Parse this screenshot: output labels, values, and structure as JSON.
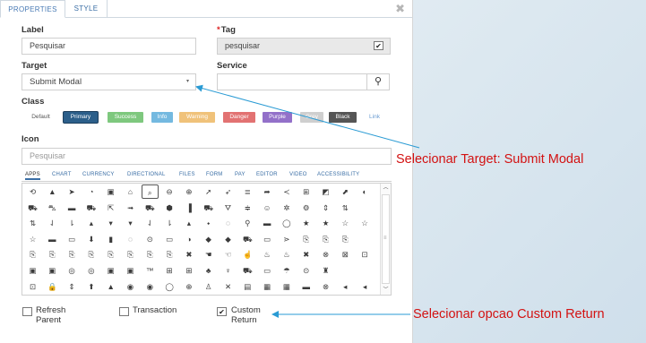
{
  "tabs": [
    {
      "label": "PROPERTIES"
    },
    {
      "label": "STYLE"
    }
  ],
  "form": {
    "label_label": "Label",
    "label_value": "Pesquisar",
    "tag_label": "Tag",
    "tag_required": "*",
    "tag_value": "pesquisar",
    "tag_checked": "✔",
    "target_label": "Target",
    "target_value": "Submit Modal",
    "service_label": "Service",
    "service_value": "",
    "class_label": "Class",
    "icon_label": "Icon",
    "icon_placeholder": "Pesquisar"
  },
  "class_buttons": [
    {
      "label": "Default",
      "color": "transparent",
      "text_color": "#555555"
    },
    {
      "label": "Primary",
      "color": "#2c5f8a",
      "text_color": "#ffffff"
    },
    {
      "label": "Success",
      "color": "#7ec87e",
      "text_color": "#ffffff"
    },
    {
      "label": "Info",
      "color": "#74b9e0",
      "text_color": "#ffffff"
    },
    {
      "label": "Warning",
      "color": "#f0c27a",
      "text_color": "#ffffff"
    },
    {
      "label": "Danger",
      "color": "#e27272",
      "text_color": "#ffffff"
    },
    {
      "label": "Purple",
      "color": "#9370c9",
      "text_color": "#ffffff"
    },
    {
      "label": "Grey",
      "color": "#cfcfcf",
      "text_color": "#ffffff"
    },
    {
      "label": "Black",
      "color": "#555555",
      "text_color": "#ffffff"
    },
    {
      "label": "Link",
      "color": "transparent",
      "text_color": "#6a9bd1"
    }
  ],
  "icon_categories": [
    {
      "label": "APPS"
    },
    {
      "label": "CHART"
    },
    {
      "label": "CURRENCY"
    },
    {
      "label": "DIRECTIONAL"
    },
    {
      "label": "FILES"
    },
    {
      "label": "FORM"
    },
    {
      "label": "PAY"
    },
    {
      "label": "EDITOR"
    },
    {
      "label": "VIDEO"
    },
    {
      "label": "ACCESSIBILITY"
    }
  ],
  "icon_rows": [
    [
      "⟲",
      "▲",
      "➤",
      "◔",
      "▣",
      "⌂",
      "⌕",
      "⊖",
      "⊕",
      "➚",
      "➶",
      "≣",
      "➦",
      "≺",
      "⊞",
      "◩",
      "⬈",
      "◐"
    ],
    [
      "⛟",
      "⛍",
      "▬",
      "⛟",
      "⇱",
      "➟",
      "⛟",
      "⬢",
      "▐",
      "⛟",
      "⛛",
      "≑",
      "☺",
      "✲",
      "⚙",
      "⇕",
      "⇅",
      ""
    ],
    [
      "⇅",
      "⇃",
      "⇂",
      "▴",
      "▾",
      "▾",
      "⇃",
      "⇂",
      "▴",
      "⬩",
      "◌",
      "⚲",
      "▬",
      "◯",
      "★",
      "★",
      "☆",
      "☆"
    ],
    [
      "☆",
      "▬",
      "▭",
      "⬇",
      "▮",
      "◌",
      "⊙",
      "▭",
      "◑",
      "◆",
      "◆",
      "⛟",
      "▭",
      "⋗",
      "⎘",
      "⎘",
      "⎘",
      ""
    ],
    [
      "⎘",
      "⎘",
      "⎘",
      "⎘",
      "⎘",
      "⎘",
      "⎘",
      "⎘",
      "✖",
      "☚",
      "☜",
      "☝",
      "♨",
      "♨",
      "✖",
      "⊗",
      "⊠",
      "⊡",
      "♨"
    ],
    [
      "▣",
      "▣",
      "◎",
      "◎",
      "▣",
      "▣",
      "™",
      "⊞",
      "⊞",
      "♣",
      "♆",
      "⛟",
      "▭",
      "☂",
      "⊙",
      "♜"
    ],
    [
      "⊡",
      "🔒",
      "⇕",
      "⬆",
      "▲",
      "◉",
      "◉",
      "◯",
      "⊕",
      "♙",
      "✕",
      "▤",
      "▦",
      "▦",
      "▬",
      "⊗",
      "◂",
      "◂"
    ]
  ],
  "checkboxes": [
    {
      "label_line1": "Refresh",
      "label_line2": "Parent",
      "mark": ""
    },
    {
      "label_line1": "Transaction",
      "label_line2": "",
      "mark": ""
    },
    {
      "label_line1": "Custom",
      "label_line2": "Return",
      "mark": "✔"
    }
  ],
  "callouts": [
    {
      "text": "Selecionar Target: Submit Modal"
    },
    {
      "text": "Selecionar opcao Custom Return"
    }
  ],
  "icons": {
    "close": "close-icon",
    "search": "search-icon",
    "dropdown": "chevron-down-icon"
  }
}
